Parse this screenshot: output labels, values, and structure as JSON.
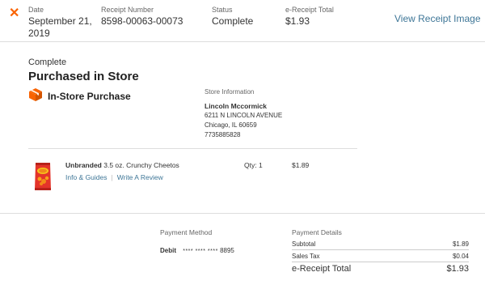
{
  "header": {
    "date_label": "Date",
    "date_value_line1": "September 21,",
    "date_value_line2": "2019",
    "receipt_label": "Receipt Number",
    "receipt_value": "8598-00063-00073",
    "status_label": "Status",
    "status_value": "Complete",
    "total_label": "e-Receipt Total",
    "total_value": "$1.93",
    "view_link": "View Receipt Image"
  },
  "order": {
    "status": "Complete",
    "title": "Purchased in Store",
    "purchase_type": "In-Store Purchase"
  },
  "store": {
    "label": "Store Information",
    "name": "Lincoln Mccormick",
    "address1": "6211 N LINCOLN AVENUE",
    "address2": "Chicago, IL 60659",
    "phone": "7735885828"
  },
  "item": {
    "brand": "Unbranded",
    "name": "3.5 oz. Crunchy Cheetos",
    "link_info": "Info & Guides",
    "link_review": "Write A Review",
    "qty": "Qty: 1",
    "price": "$1.89"
  },
  "payment_method": {
    "label": "Payment Method",
    "type": "Debit",
    "masked": "**** **** ****",
    "last4": "8895"
  },
  "payment_details": {
    "label": "Payment Details",
    "subtotal_label": "Subtotal",
    "subtotal_value": "$1.89",
    "tax_label": "Sales Tax",
    "tax_value": "$0.04",
    "total_label": "e-Receipt Total",
    "total_value": "$1.93"
  },
  "colors": {
    "accent": "#f96302",
    "link": "#3e7697"
  }
}
